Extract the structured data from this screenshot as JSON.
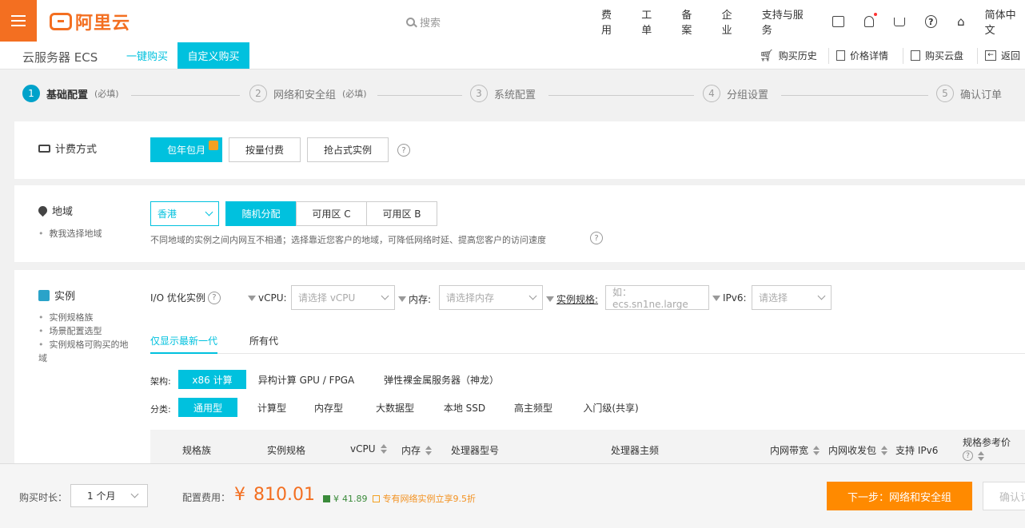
{
  "header": {
    "logo_text": "阿里云",
    "search_placeholder": "搜索",
    "nav": [
      "费用",
      "工单",
      "备案",
      "企业",
      "支持与服务"
    ],
    "lang": "简体中文"
  },
  "subbar": {
    "product": "云服务器 ECS",
    "tab_quick": "一键购买",
    "tab_custom": "自定义购买",
    "actions": [
      "购买历史",
      "价格详情",
      "购买云盘",
      "返回"
    ]
  },
  "steps": [
    {
      "num": "1",
      "label": "基础配置",
      "req": "(必填)"
    },
    {
      "num": "2",
      "label": "网络和安全组",
      "req": "(必填)"
    },
    {
      "num": "3",
      "label": "系统配置",
      "req": ""
    },
    {
      "num": "4",
      "label": "分组设置",
      "req": ""
    },
    {
      "num": "5",
      "label": "确认订单",
      "req": ""
    }
  ],
  "billing": {
    "title": "计费方式",
    "options": [
      "包年包月",
      "按量付费",
      "抢占式实例"
    ]
  },
  "region": {
    "title": "地域",
    "help": "教我选择地域",
    "selected": "香港",
    "zones": [
      "随机分配",
      "可用区 C",
      "可用区 B"
    ],
    "note": "不同地域的实例之间内网互不相通；选择靠近您客户的地域，可降低网络时延、提高您客户的访问速度"
  },
  "instance": {
    "title": "实例",
    "helps": [
      "实例规格族",
      "场景配置选型",
      "实例规格可购买的地域"
    ],
    "io_label": "I/O 优化实例",
    "filters": {
      "vcpu_label": "vCPU:",
      "vcpu_placeholder": "请选择 vCPU",
      "mem_label": "内存:",
      "mem_placeholder": "请选择内存",
      "spec_label": "实例规格:",
      "spec_placeholder": "如：ecs.sn1ne.large",
      "ipv6_label": "IPv6:",
      "ipv6_placeholder": "请选择"
    },
    "gen_tabs": [
      "仅显示最新一代",
      "所有代"
    ],
    "arch_label": "架构:",
    "arch": [
      "x86 计算",
      "异构计算 GPU / FPGA",
      "弹性裸金属服务器（神龙）"
    ],
    "cat_label": "分类:",
    "categories": [
      "通用型",
      "计算型",
      "内存型",
      "大数据型",
      "本地 SSD",
      "高主频型",
      "入门级(共享)"
    ],
    "columns": [
      "规格族",
      "实例规格",
      "vCPU",
      "内存",
      "处理器型号",
      "处理器主频",
      "内网带宽",
      "内网收发包",
      "支持 IPv6",
      "规格参考价"
    ]
  },
  "footer": {
    "duration_label": "购买时长：",
    "duration": "1 个月",
    "cost_label": "配置费用：",
    "currency": "¥",
    "price": "810.01",
    "save_currency": "¥",
    "save": "41.89",
    "promo": "专有网络实例立享9.5折",
    "next_button": "下一步：网络和安全组",
    "confirm_button": "确认订单"
  },
  "colors": {
    "brand": "#f36f21",
    "accent": "#00c1de"
  }
}
